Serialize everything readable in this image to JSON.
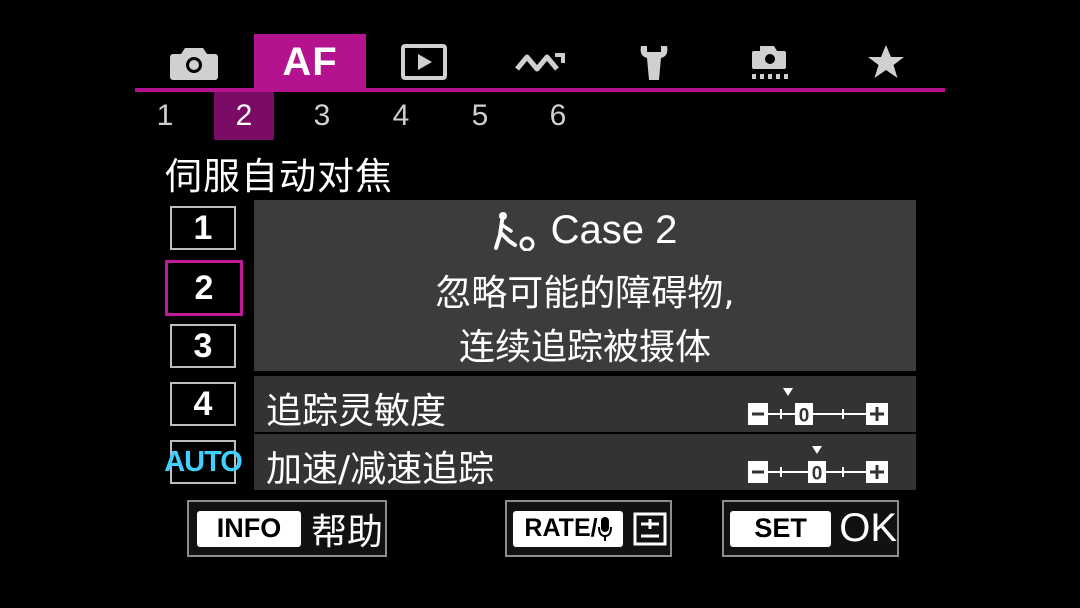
{
  "tabs": [
    {
      "icon": "camera-icon"
    },
    {
      "label": "AF",
      "active": true
    },
    {
      "icon": "playback-icon"
    },
    {
      "icon": "wireless-icon"
    },
    {
      "icon": "wrench-icon"
    },
    {
      "icon": "custom-function-icon"
    },
    {
      "icon": "star-icon"
    }
  ],
  "pages": [
    "1",
    "2",
    "3",
    "4",
    "5",
    "6"
  ],
  "active_page": "2",
  "title": "伺服自动对焦",
  "cases": [
    {
      "label": "1"
    },
    {
      "label": "2",
      "selected": true
    },
    {
      "label": "3"
    },
    {
      "label": "4"
    },
    {
      "label": "AUTO"
    }
  ],
  "description": {
    "case_label": "Case 2",
    "case_icon": "athlete-ball-icon",
    "line1": "忽略可能的障碍物,",
    "line2": "连续追踪被摄体"
  },
  "params": [
    {
      "label": "追踪灵敏度",
      "scale_labels": [
        "−",
        "0",
        "+"
      ],
      "value": 0
    },
    {
      "label": "加速/减速追踪",
      "scale_labels": [
        "−",
        "0",
        "+"
      ],
      "value": 0
    }
  ],
  "buttons": {
    "info_key": "INFO",
    "info_label": "帮助",
    "rate_key": "RATE/",
    "set_key": "SET",
    "set_label": "OK"
  },
  "colors": {
    "accent": "#b5128f",
    "active_page_bg": "#7a0c66",
    "auto_text": "#3fd0ff",
    "panel_bg": "#3c3c3c"
  }
}
